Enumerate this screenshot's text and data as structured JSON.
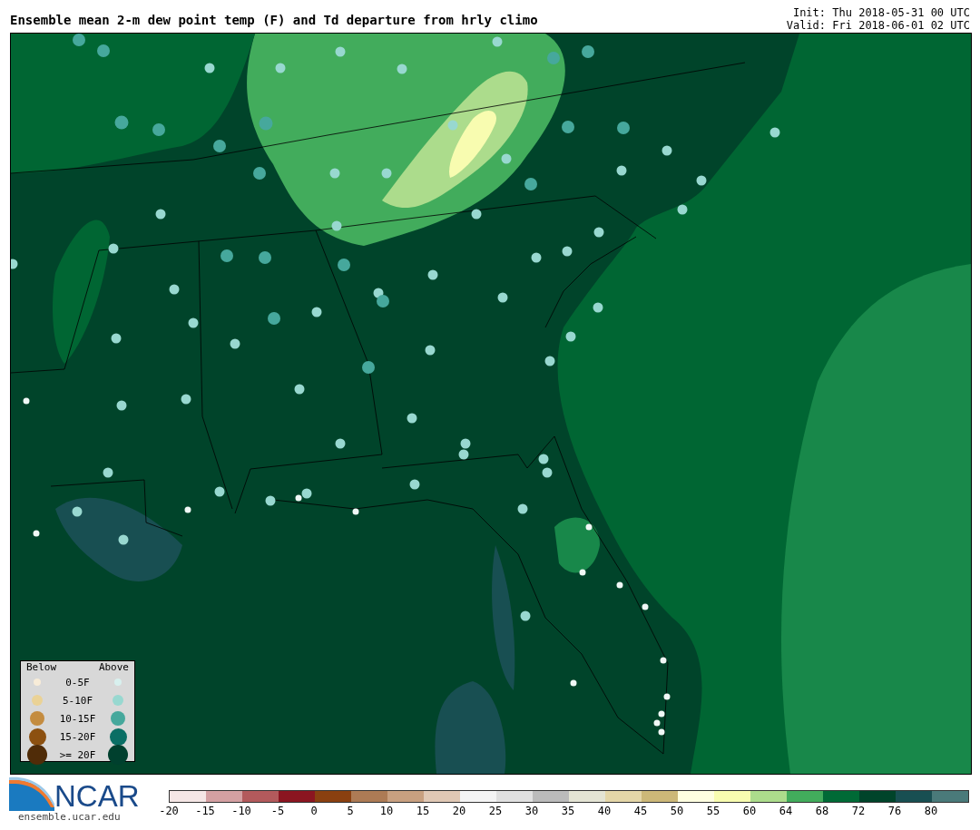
{
  "title": "Ensemble mean 2-m dew point temp (F) and Td departure from hrly climo",
  "init": "Init: Thu 2018-05-31 00 UTC",
  "valid": "Valid: Fri 2018-06-01 02 UTC",
  "legend": {
    "below_heading": "Below",
    "above_heading": "Above",
    "rows": [
      {
        "label": "0-5F",
        "dots": [
          {
            "color": "#f8ecd8"
          },
          {
            "color": "#d8f0ee"
          }
        ]
      },
      {
        "label": "5-10F",
        "dots": [
          {
            "color": "#ead296"
          },
          {
            "color": "#98d8d0"
          }
        ]
      },
      {
        "label": "10-15F",
        "dots": [
          {
            "color": "#c48c40"
          },
          {
            "color": "#46a89c"
          }
        ]
      },
      {
        "label": "15-20F",
        "dots": [
          {
            "color": "#8c5010"
          },
          {
            "color": "#0a6e64"
          }
        ]
      },
      {
        "label": ">= 20F",
        "dots": [
          {
            "color": "#502c08"
          },
          {
            "color": "#00402e"
          }
        ]
      }
    ]
  },
  "logo": {
    "text": "NCAR",
    "url": "ensemble.ucar.edu"
  },
  "colorbar": {
    "segments": [
      {
        "color": "#f5e6e5"
      },
      {
        "color": "#d4a0a2"
      },
      {
        "color": "#b35a5c"
      },
      {
        "color": "#8b1520"
      },
      {
        "color": "#8a4010"
      },
      {
        "color": "#ad7b55"
      },
      {
        "color": "#c8a080"
      },
      {
        "color": "#e0c8b5"
      },
      {
        "color": "#f4f4f4"
      },
      {
        "color": "#e0e0e0"
      },
      {
        "color": "#bbbbbb"
      },
      {
        "color": "#e4e4d4"
      },
      {
        "color": "#e4d6a8"
      },
      {
        "color": "#ccb878"
      },
      {
        "color": "#fefee0"
      },
      {
        "color": "#f8fcb0"
      },
      {
        "color": "#acdc8c"
      },
      {
        "color": "#42ac5c"
      },
      {
        "color": "#006a36"
      },
      {
        "color": "#00442a"
      },
      {
        "color": "#184f52"
      },
      {
        "color": "#4a7a7a"
      }
    ],
    "ticks": [
      "-20",
      "-15",
      "-10",
      "-5",
      "0",
      "5",
      "10",
      "15",
      "20",
      "25",
      "30",
      "35",
      "40",
      "45",
      "50",
      "55",
      "60",
      "64",
      "68",
      "72",
      "76",
      "80"
    ]
  }
}
